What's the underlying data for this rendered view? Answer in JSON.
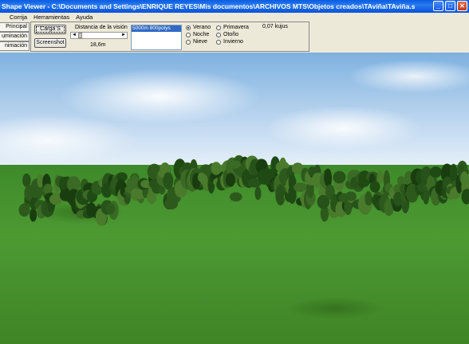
{
  "window": {
    "title": "Shape Viewer - C:\\Documents and Settings\\ENRIQUE REYES\\Mis documentos\\ARCHIVOS MTS\\Objetos creados\\TAviña\\TAviña.s",
    "controls": [
      "_",
      "□",
      "✕"
    ]
  },
  "menu": [
    "Corrija",
    "Herramientas",
    "Ayuda"
  ],
  "side_tabs": [
    "Principal",
    "uminación",
    "nimación"
  ],
  "panel": {
    "load_button": "Carga S",
    "screenshot_button": "Screenshot",
    "vision_label": "Distancia de la visión",
    "slider_left": "◄",
    "slider_right": "►",
    "vision_value": "18,6m",
    "list_selected": "5000m 800polys",
    "seasons": [
      {
        "label": "Verano",
        "checked": true
      },
      {
        "label": "Primavera",
        "checked": false
      },
      {
        "label": "Noche",
        "checked": false
      },
      {
        "label": "Otoño",
        "checked": false
      },
      {
        "label": "Nieve",
        "checked": false
      },
      {
        "label": "Invierno",
        "checked": false
      }
    ],
    "stat": "0,07 kujus"
  },
  "colors": {
    "sky": "#7eb1e0",
    "grass": "#3e8a2a",
    "foliage": "#2d5a1c"
  }
}
